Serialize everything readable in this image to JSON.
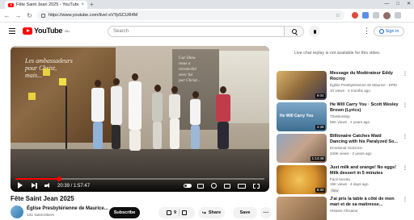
{
  "browser": {
    "tab_title": "Fête Saint Jean 2025 - YouTube",
    "tab_close": "×",
    "new_tab": "+",
    "window_controls": [
      "—",
      "□",
      "✕"
    ],
    "nav": [
      "←",
      "→",
      "↻"
    ],
    "url": "https://www.youtube.com/live/-sVYpSCUR4M",
    "bookmark_star": "☆"
  },
  "header": {
    "logo_text": "YouTube",
    "logo_region": "MU",
    "search_placeholder": "Search",
    "more_options": "⋮",
    "sign_in_label": "Sign in"
  },
  "video": {
    "banner_left_text": "Les ambassadeurs\npour Christ,\nmais...",
    "banner_center_text": "Car Dieu\nnous a\nréconcilié\navec lui\npar Christ...",
    "time_display": "20:39 / 1:57:47",
    "progress_fraction": 0.175,
    "title": "Fête Saint Jean 2025",
    "channel_name": "Église Presbytérienne de Maurice...",
    "subscriber_count": "131 subscribers",
    "subscribe_label": "Subscribe",
    "like_count": "9",
    "share_label": "Share",
    "save_label": "Save",
    "more_label": "···"
  },
  "sidebar": {
    "live_replay_note": "Live chat replay is not available for this video.",
    "menu_glyph": "⋮",
    "items": [
      {
        "title": "Message du Modérateur Eddy Rocroy",
        "channel": "Église Presbytérienne de Maurice - EPM",
        "meta": "10 views · 4 months ago",
        "duration": "9:04",
        "thumb_text": "",
        "badge": ""
      },
      {
        "title": "He Will Carry You · Scott Wesley Brown (Lyrics)",
        "channel": "TheWorship",
        "meta": "56K views · 2 years ago",
        "duration": "4:38",
        "thumb_text": "He Will Carry You",
        "badge": ""
      },
      {
        "title": "Billionaire Catches Maid Dancing with his Paralyzed So...",
        "channel": "Emotional Horizons",
        "meta": "249K views · 2 years ago",
        "duration": "1:14:48",
        "thumb_text": "",
        "badge": ""
      },
      {
        "title": "Just milk and orange! No eggs! Milk dessert in 5 minutes",
        "channel": "Fácil receita",
        "meta": "15K views · 4 days ago",
        "duration": "8:30",
        "thumb_text": "",
        "badge": "New"
      },
      {
        "title": "J'ai pris la table à côté de mon mari et de sa maitresse...",
        "channel": "Histoire Africaine",
        "meta": "",
        "duration": "",
        "thumb_text": "",
        "badge": ""
      }
    ]
  },
  "colors": {
    "brand_red": "#ff0000",
    "link_blue": "#065fd4"
  }
}
